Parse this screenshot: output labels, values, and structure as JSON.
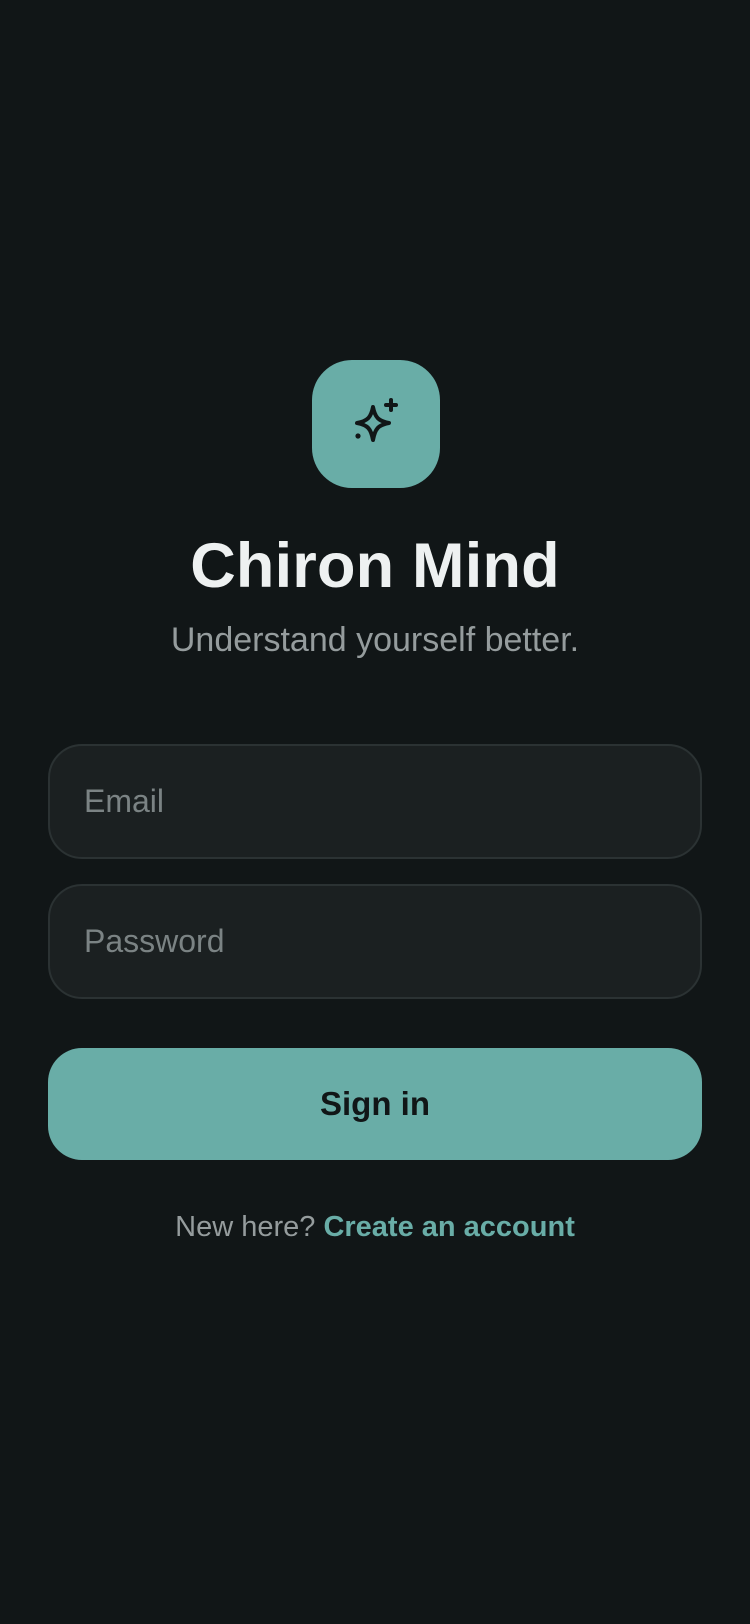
{
  "app": {
    "title": "Chiron Mind",
    "tagline": "Understand yourself better.",
    "logo_icon": "sparkles-icon"
  },
  "form": {
    "email": {
      "value": "",
      "placeholder": "Email"
    },
    "password": {
      "value": "",
      "placeholder": "Password"
    },
    "submit_label": "Sign in"
  },
  "footer": {
    "prompt": "New here?",
    "link_label": "Create an account"
  },
  "colors": {
    "background": "#111617",
    "accent": "#69ada7",
    "field_background": "#1b2021",
    "field_border": "#2b3233",
    "title_text": "#eef1f1",
    "muted_text": "#959c9d"
  }
}
